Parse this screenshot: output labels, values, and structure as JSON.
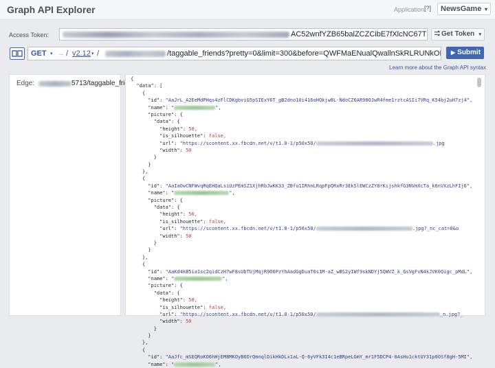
{
  "header": {
    "title": "Graph API Explorer",
    "application_label": "Application:",
    "help_label": "[?]",
    "app_name": "NewsGame",
    "app_caret": "▾"
  },
  "token": {
    "label": "Access Token:",
    "visible_suffix": "AC52wnfYZB65balZCZCibE7fXlcNC67TFRmNsohc",
    "info_label": "i",
    "get_token_label": "Get Token",
    "get_token_caret": "▾"
  },
  "query": {
    "method": "GET",
    "method_caret": "▾",
    "arrow": "→",
    "slash": "/",
    "version": "v2.12",
    "version_caret": "▾",
    "path_suffix": "/taggable_friends?pretty=0&limit=300&before=QWFMaENualQwallnSkRLRUNkOFlCYkZAjbUxWR",
    "star": "☆",
    "submit_label": "Submit",
    "learn_more": "Learn more about the Graph API syntax"
  },
  "edge": {
    "label": "Edge:",
    "value_suffix": "5713/taggable_friends"
  },
  "icons": {
    "book": "book-icon",
    "star": "star-icon",
    "info": "info-icon"
  },
  "colors": {
    "accent": "#4267b2",
    "link": "#365899",
    "string": "#2e3b8f",
    "number": "#c43a31"
  },
  "response_lines": [
    {
      "t": "{"
    },
    {
      "t": "  \"data\": ["
    },
    {
      "t": "    {"
    },
    {
      "t": "      \"id\": \"AaJrL_A2EeMdPHqs4zFlCDKgbviG5pSIExY6T_gB2dno10i416oHQkjw8L-NdoCZ6AR98OJwR4fme1rztcASIi7VRq_K54bj2uH7zj4\",",
      "k": "s"
    },
    {
      "t": "      \"name\": \"",
      "b": 60,
      "g": 1,
      "after": "\","
    },
    {
      "t": "      \"picture\": {"
    },
    {
      "t": "        \"data\": {"
    },
    {
      "t": "          \"height\": 50,",
      "k": "n"
    },
    {
      "t": "          \"is_silhouette\": false,",
      "k": "b"
    },
    {
      "t": "          \"url\": \"https://scontent.xx.fbcdn.net/v/t1.0-1/p50x50/",
      "b": 170,
      "after": ".jpg"
    },
    {
      "t": "          \"width\": 50",
      "k": "n"
    },
    {
      "t": "        }"
    },
    {
      "t": "      }"
    },
    {
      "t": "    },"
    },
    {
      "t": "    {"
    },
    {
      "t": "      \"id\": \"AaIaOwCNFWvqRqEHQaLsiUzPEmSZ1XjhRbJwKK33_ZBfu1IRhnLRqpFpQRxRr3EkSlEWCzZY8rKijshkfG3NVmXcTa_k6nVXzLhFIj6\",",
      "k": "s"
    },
    {
      "t": "      \"name\": \"",
      "b": 80,
      "g": 1,
      "after": "\","
    },
    {
      "t": "      \"picture\": {"
    },
    {
      "t": "        \"data\": {"
    },
    {
      "t": "          \"height\": 50,",
      "k": "n"
    },
    {
      "t": "          \"is_silhouette\": false,",
      "k": "b"
    },
    {
      "t": "          \"url\": \"https://scontent.xx.fbcdn.net/v/t1.0-1/p50x50/",
      "b": 140,
      "after": ".jpg?_nc_cat=0&o"
    },
    {
      "t": "          \"width\": 50",
      "k": "n"
    },
    {
      "t": "        }"
    },
    {
      "t": "      }"
    },
    {
      "t": "    },"
    },
    {
      "t": "    {"
    },
    {
      "t": "      \"id\": \"AaKd4kB5ia1sc2qidCzH7wF8sUbTUjMqjR9O6PzYhAadGgDuaT6s1M-aZ_wBS2yIWf9skNDYj5QWVZ_k_GsVgFvN4kJVK0Qigc_pMdL\",",
      "k": "s"
    },
    {
      "t": "      \"name\": \"",
      "b": 70,
      "g": 1,
      "after": "\","
    },
    {
      "t": "      \"picture\": {"
    },
    {
      "t": "        \"data\": {"
    },
    {
      "t": "          \"height\": 50,",
      "k": "n"
    },
    {
      "t": "          \"is_silhouette\": false,",
      "k": "b"
    },
    {
      "t": "          \"url\": \"https://scontent.xx.fbcdn.net/v/t1.0-1/p50x50/",
      "b": 180,
      "after": "_n.jpg?_"
    },
    {
      "t": "          \"width\": 50",
      "k": "n"
    },
    {
      "t": "        }"
    },
    {
      "t": "      }"
    },
    {
      "t": "    },"
    },
    {
      "t": "    {"
    },
    {
      "t": "      \"id\": \"AaJfc_mSEQRoKO6hHjEM8MKOyB6OrQmnqlDikHkDLx1aL-Q-6yVFk3I4c1eBRpeLGmY_mr1F5DCP4-0AsHu1cktUY31p0OSf8gH-5MI\",",
      "k": "s"
    },
    {
      "t": "      \"name\": \"",
      "b": 60,
      "g": 1,
      "after": "\","
    }
  ]
}
